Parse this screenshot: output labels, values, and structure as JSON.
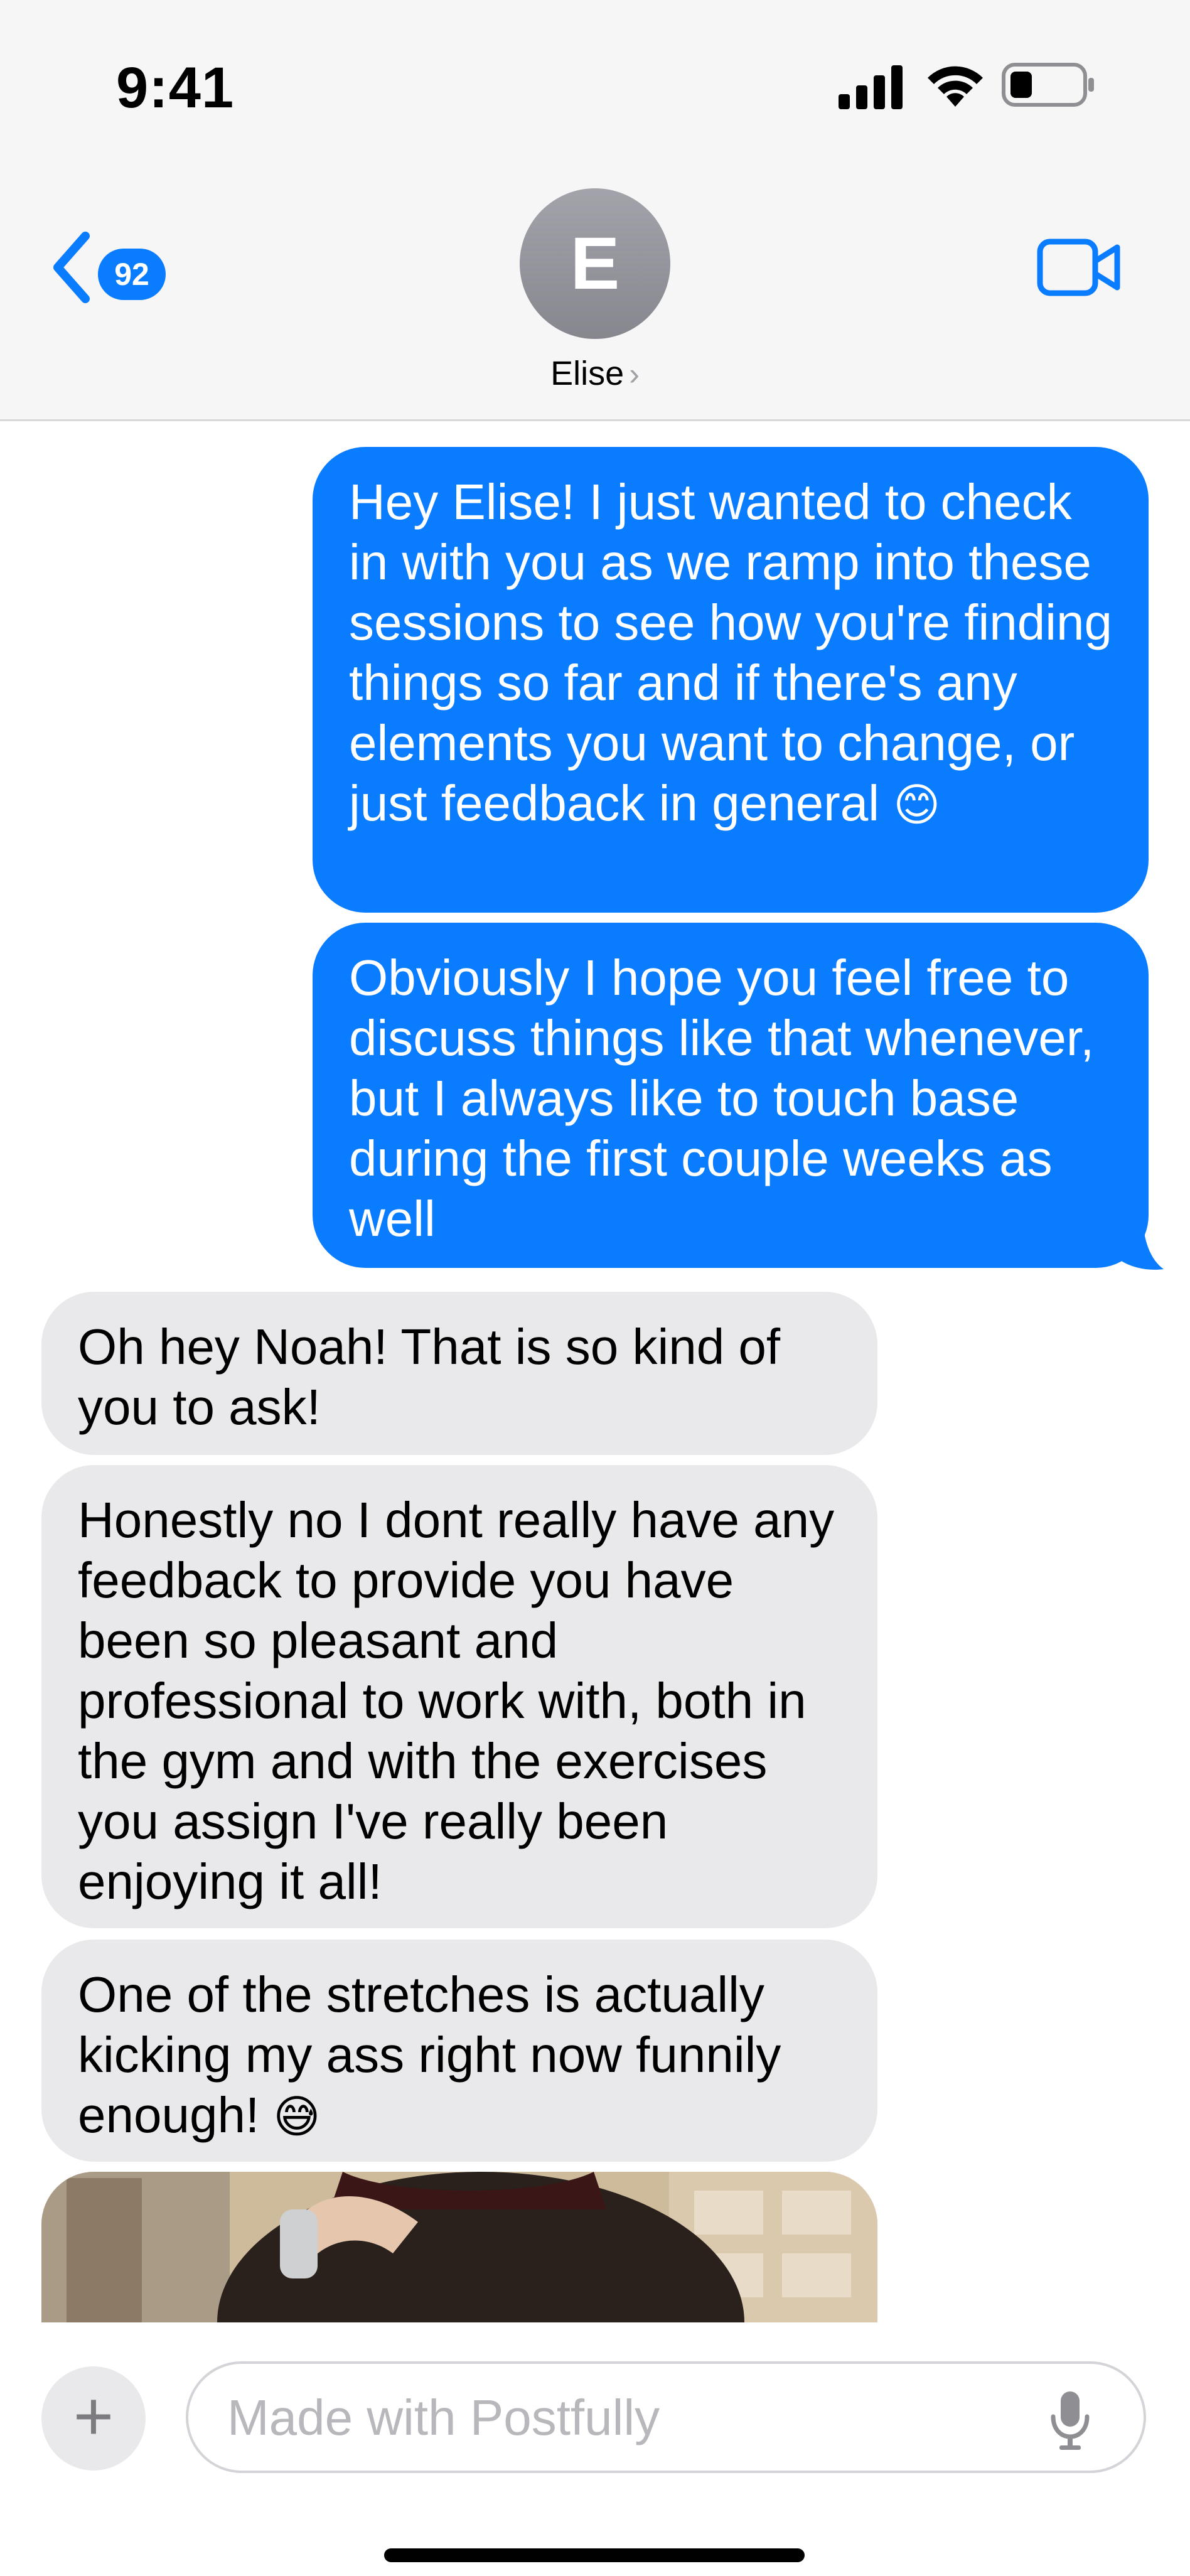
{
  "status_bar": {
    "time": "9:41",
    "icons": [
      "cellular-signal-icon",
      "wifi-icon",
      "battery-icon"
    ]
  },
  "header": {
    "unread_count": "92",
    "avatar_initial": "E",
    "contact_name": "Elise",
    "chevron": "›",
    "video_call_icon": "video-camera-icon",
    "back_icon": "chevron-left-icon"
  },
  "messages": [
    {
      "direction": "sent",
      "text": "Hey Elise! I just wanted to check in with you as we ramp into these sessions to see how you're finding things so far and if there's any elements you want to change, or just feedback in general",
      "emoji": "😊"
    },
    {
      "direction": "sent",
      "text": "Obviously I hope you feel free to discuss things like that whenever, but I always like to touch base during the first couple weeks as well",
      "emoji": ""
    },
    {
      "direction": "received",
      "text": "Oh hey Noah! That is so kind of you to ask!",
      "emoji": ""
    },
    {
      "direction": "received",
      "text": "Honestly no I dont really have any feedback to provide you have been so pleasant and professional to work with, both in the gym and with the exercises you assign I've really been enjoying it all!",
      "emoji": ""
    },
    {
      "direction": "received",
      "text": "One of the stretches is actually kicking my ass right now funnily enough!",
      "emoji": "😅"
    }
  ],
  "colors": {
    "sent_bubble": "#0a7cff",
    "received_bubble": "#e9e9eb",
    "header_bg": "#f6f6f6"
  },
  "composer": {
    "placeholder": "Made with Postfully",
    "add_icon": "plus-icon",
    "mic_icon": "microphone-icon"
  }
}
